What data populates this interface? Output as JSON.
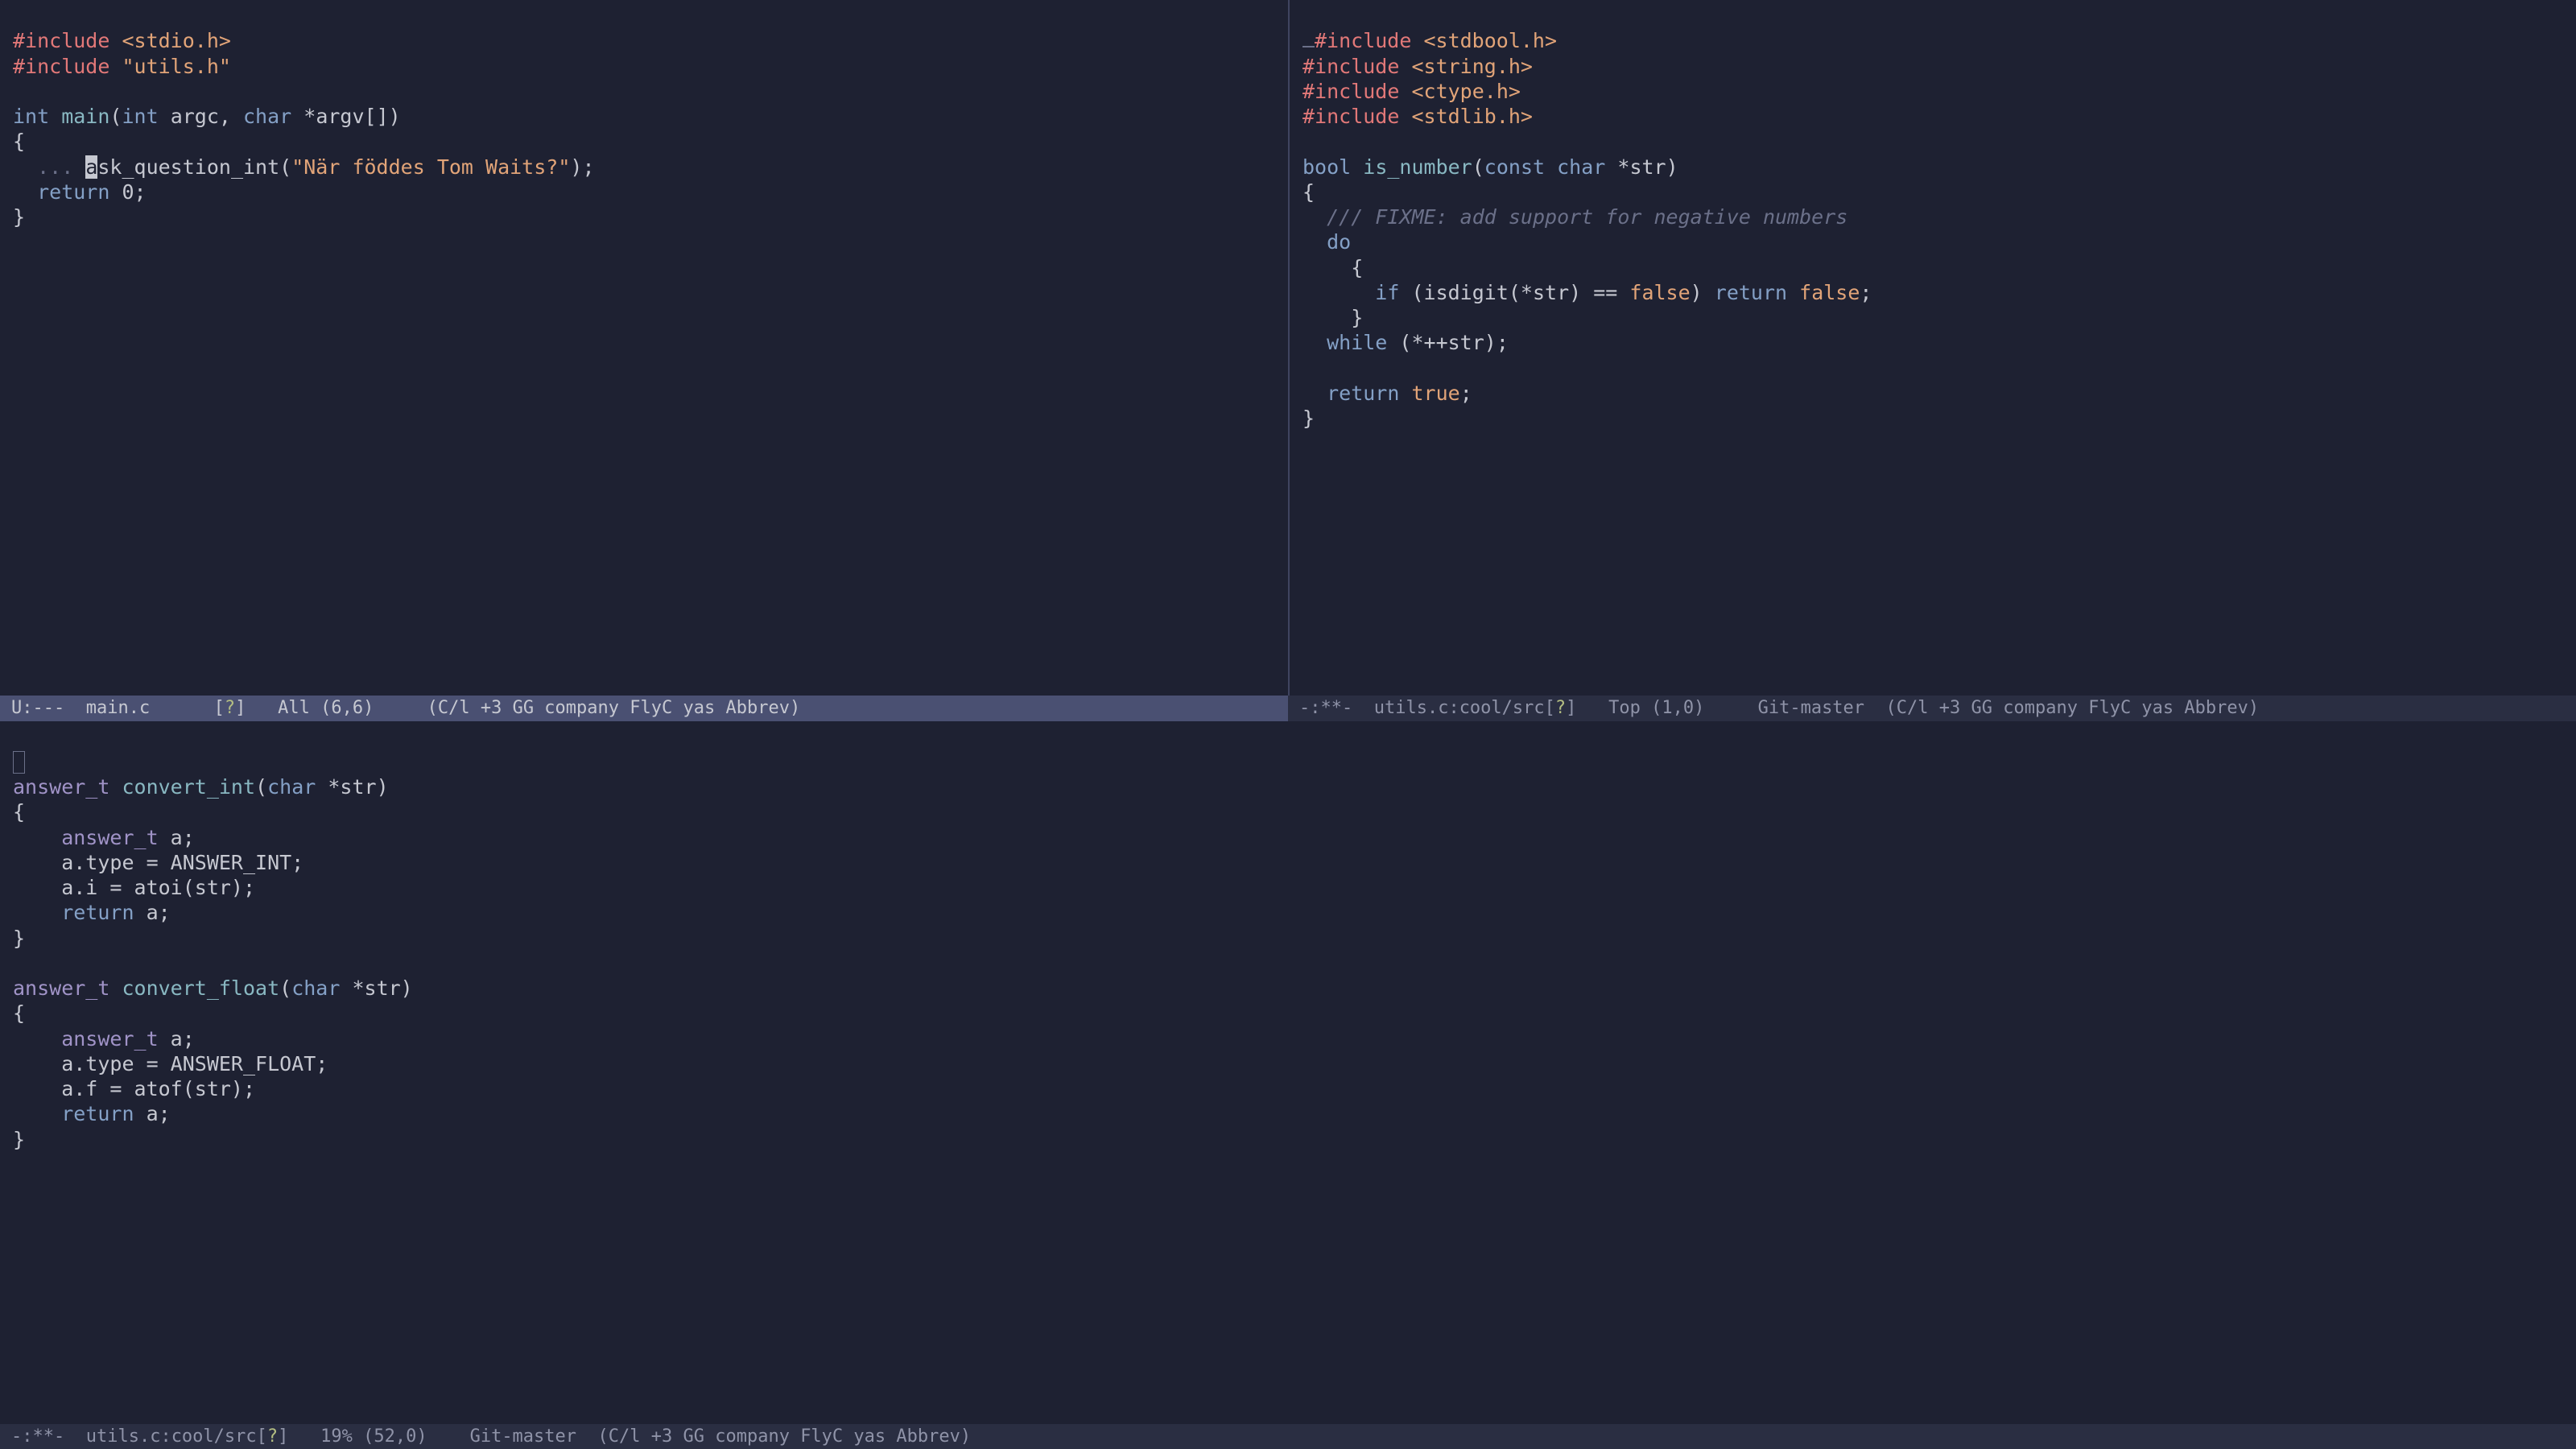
{
  "panes": {
    "top_left": {
      "lines": {
        "l1_pp": "#include ",
        "l1_str": "<stdio.h>",
        "l2_pp": "#include ",
        "l2_str": "\"utils.h\"",
        "blank1": "",
        "l4_kw1": "int",
        "l4_fn": " main",
        "l4_open": "(",
        "l4_kw2": "int",
        "l4_arg1": " argc, ",
        "l4_kw3": "char",
        "l4_arg2": " *argv[])",
        "l5": "{",
        "l6_fold": "  ... ",
        "l6_cur": "a",
        "l6_rest": "sk_question_int(",
        "l6_str": "\"När föddes Tom Waits?\"",
        "l6_end": ");",
        "l7_ret": "  return",
        "l7_zero": " 0;",
        "l8": "}"
      }
    },
    "top_right": {
      "lines": {
        "i1_pp": "#include ",
        "i1_str": "<stdbool.h>",
        "i2_pp": "#include ",
        "i2_str": "<string.h>",
        "i3_pp": "#include ",
        "i3_str": "<ctype.h>",
        "i4_pp": "#include ",
        "i4_str": "<stdlib.h>",
        "blank1": "",
        "f1_kw": "bool",
        "f1_fn": " is_number",
        "f1_open": "(",
        "f1_kw2": "const",
        "f1_sp": " ",
        "f1_kw3": "char",
        "f1_rest": " *str)",
        "f2": "{",
        "f3_cmt": "  /// FIXME: add support for negative numbers",
        "f4_do": "  do",
        "f5": "    {",
        "f6_if": "      if",
        "f6_mid": " (isdigit(*str) == ",
        "f6_false": "false",
        "f6_paren": ") ",
        "f6_ret": "return",
        "f6_sp": " ",
        "f6_false2": "false",
        "f6_semi": ";",
        "f7": "    }",
        "f8_while": "  while",
        "f8_rest": " (*++str);",
        "blank2": "",
        "f9_ret": "  return",
        "f9_sp": " ",
        "f9_true": "true",
        "f9_semi": ";",
        "f10": "}"
      }
    },
    "bottom": {
      "lines": {
        "c1_ty": "answer_t",
        "c1_fn": " convert_int",
        "c1_open": "(",
        "c1_kw": "char",
        "c1_rest": " *str)",
        "c2": "{",
        "c3_ty": "    answer_t",
        "c3_rest": " a;",
        "c4": "    a.type = ANSWER_INT;",
        "c5": "    a.i = atoi(str);",
        "c6_ret": "    return",
        "c6_rest": " a;",
        "c7": "}",
        "blank1": "",
        "d1_ty": "answer_t",
        "d1_fn": " convert_float",
        "d1_open": "(",
        "d1_kw": "char",
        "d1_rest": " *str)",
        "d2": "{",
        "d3_ty": "    answer_t",
        "d3_rest": " a;",
        "d4": "    a.type = ANSWER_FLOAT;",
        "d5": "    a.f = atof(str);",
        "d6_ret": "    return",
        "d6_rest": " a;",
        "d7": "}"
      }
    }
  },
  "modelines": {
    "top_left": {
      "flags": "U:--- ",
      "buffer": " main.c",
      "spacer1": "      [",
      "flymake": "?",
      "bracket_close": "]   ",
      "pos": "All (6,6)",
      "spacer2": "     ",
      "modes": "(C/l +3 GG company FlyC yas Abbrev)"
    },
    "top_right": {
      "flags": "-:**- ",
      "buffer": " utils.c:cool/src",
      "open_br": "[",
      "flymake": "?",
      "close_br": "]   ",
      "pos": "Top (1,0)",
      "spacer2": "     ",
      "vc": "Git-master",
      "spacer3": "  ",
      "modes": "(C/l +3 GG company FlyC yas Abbrev)"
    },
    "bottom": {
      "flags": "-:**- ",
      "buffer": " utils.c:cool/src",
      "open_br": "[",
      "flymake": "?",
      "close_br": "]   ",
      "pos": "19% (52,0)",
      "spacer2": "    ",
      "vc": "Git-master",
      "spacer3": "  ",
      "modes": "(C/l +3 GG company FlyC yas Abbrev)"
    }
  }
}
